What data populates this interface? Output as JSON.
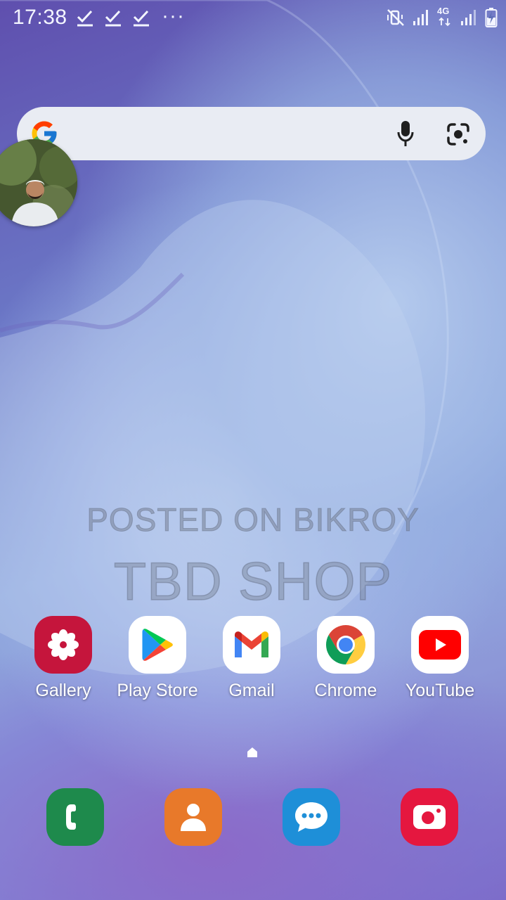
{
  "status_bar": {
    "time": "17:38",
    "overflow": "···",
    "network": "4G",
    "icons": [
      "check-icon",
      "check-icon",
      "check-icon",
      "mute-vibrate-icon",
      "signal-icon",
      "signal-icon",
      "battery-charging-icon"
    ]
  },
  "search": {
    "logo": "google-g-icon",
    "voice_icon": "mic-icon",
    "lens_icon": "google-lens-icon"
  },
  "watermark": {
    "line1": "POSTED ON BIKROY",
    "line2": "TBD SHOP"
  },
  "apps": [
    {
      "label": "Gallery",
      "icon": "gallery-icon",
      "color": "#c5153c"
    },
    {
      "label": "Play Store",
      "icon": "play-store-icon",
      "color": "#ffffff"
    },
    {
      "label": "Gmail",
      "icon": "gmail-icon",
      "color": "#ffffff"
    },
    {
      "label": "Chrome",
      "icon": "chrome-icon",
      "color": "#ffffff"
    },
    {
      "label": "YouTube",
      "icon": "youtube-icon",
      "color": "#ffffff"
    }
  ],
  "dock": [
    {
      "icon": "phone-icon",
      "color": "#1e8a4c"
    },
    {
      "icon": "contacts-icon",
      "color": "#e8792a"
    },
    {
      "icon": "messages-icon",
      "color": "#1e8fd8"
    },
    {
      "icon": "camera-icon",
      "color": "#e5173f"
    }
  ],
  "colors": {
    "search_bg": "#e9ecf3",
    "text_light": "#ffffff"
  }
}
